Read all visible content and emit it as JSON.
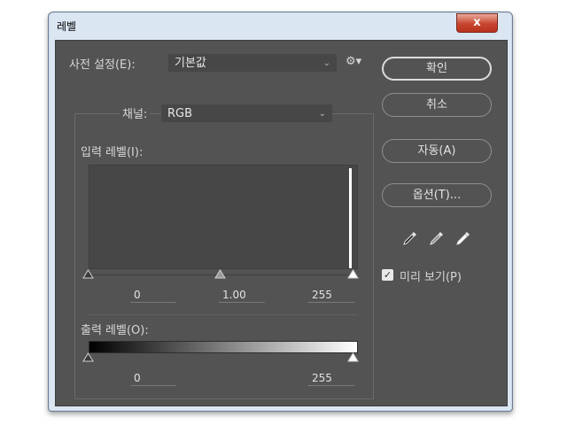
{
  "window": {
    "title": "레벨",
    "close_label": "x"
  },
  "preset": {
    "label": "사전 설정(E):",
    "value": "기본값"
  },
  "channel": {
    "label": "채널:",
    "value": "RGB"
  },
  "input": {
    "label": "입력 레벨(I):",
    "black": "0",
    "gamma": "1.00",
    "white": "255"
  },
  "output": {
    "label": "출력 레벨(O):",
    "black": "0",
    "white": "255"
  },
  "buttons": {
    "ok": "확인",
    "cancel": "취소",
    "auto": "자동(A)",
    "options": "옵션(T)..."
  },
  "preview": {
    "label": "미리 보기(P)",
    "checked": true
  },
  "icons": {
    "gear": "gear-icon",
    "dropdown": "chevron-down-icon",
    "eyedroppers": [
      "black-eyedropper-icon",
      "gray-eyedropper-icon",
      "white-eyedropper-icon"
    ]
  },
  "colors": {
    "panel": "#535353",
    "titlebar": "#dbe6f3",
    "close": "#c7452f"
  }
}
